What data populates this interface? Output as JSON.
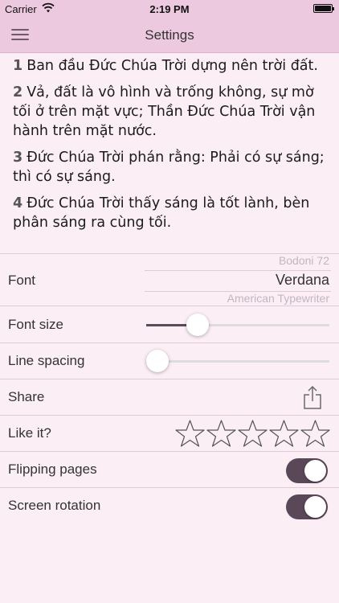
{
  "status_bar": {
    "carrier": "Carrier",
    "time": "2:19 PM"
  },
  "nav": {
    "title": "Settings"
  },
  "preview": {
    "verses": [
      {
        "num": "1",
        "text": "Ban đầu Đức Chúa Trời dựng nên trời đất."
      },
      {
        "num": "2",
        "text": "Vả, đất là vô hình và trống không, sự mờ tối ở trên mặt vực; Thần Đức Chúa Trời vận hành trên mặt nước."
      },
      {
        "num": "3",
        "text": "Đức Chúa Trời phán rằng: Phải có sự sáng; thì có sự sáng."
      },
      {
        "num": "4",
        "text": "Đức Chúa Trời thấy sáng là tốt lành, bèn phân sáng ra cùng tối."
      }
    ]
  },
  "settings": {
    "font": {
      "label": "Font",
      "option_above": "Bodoni 72",
      "selected": "Verdana",
      "option_below": "American Typewriter"
    },
    "font_size": {
      "label": "Font size",
      "value_fraction": 0.25
    },
    "line_spacing": {
      "label": "Line spacing",
      "value_fraction": 0.0
    },
    "share": {
      "label": "Share",
      "icon": "share-icon"
    },
    "like": {
      "label": "Like it?",
      "stars_total": 5,
      "stars_filled": 0
    },
    "flipping_pages": {
      "label": "Flipping pages",
      "on": true
    },
    "screen_rotation": {
      "label": "Screen rotation",
      "on": true
    }
  },
  "colors": {
    "bar_background": "#ecc9df",
    "page_background": "#fbeef5",
    "accent": "#5a4757"
  }
}
